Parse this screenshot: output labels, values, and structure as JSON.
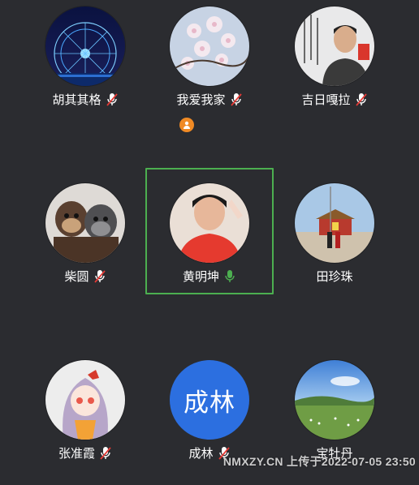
{
  "participants": [
    {
      "name": "胡其其格",
      "mic": "muted",
      "avatar": "ferris-wheel-night-photo"
    },
    {
      "name": "我爱我家",
      "mic": "muted",
      "avatar": "cherry-blossom-photo",
      "host_badge": true
    },
    {
      "name": "吉日嘎拉",
      "mic": "muted",
      "avatar": "man-portrait-photo"
    },
    {
      "name": "柴圆",
      "mic": "muted",
      "avatar": "plush-toys-photo"
    },
    {
      "name": "黄明坤",
      "mic": "active",
      "avatar": "woman-portrait-photo",
      "speaking": true
    },
    {
      "name": "田珍珠",
      "mic": "none",
      "avatar": "tiananmen-photo"
    },
    {
      "name": "张准霞",
      "mic": "muted",
      "avatar": "cartoon-girl-photo"
    },
    {
      "name": "成林",
      "mic": "muted",
      "avatar_text": "成林"
    },
    {
      "name": "宝牡丹",
      "mic": "none",
      "avatar": "grassland-photo"
    }
  ],
  "colors": {
    "background": "#2b2c30",
    "speaking_border": "#4caf50",
    "mic_active": "#4caf50",
    "mic_muted": "#e53935",
    "text_avatar_bg": "#2c6fe0"
  },
  "watermark": "NMXZY.CN 上传于2022-07-05  23:50"
}
